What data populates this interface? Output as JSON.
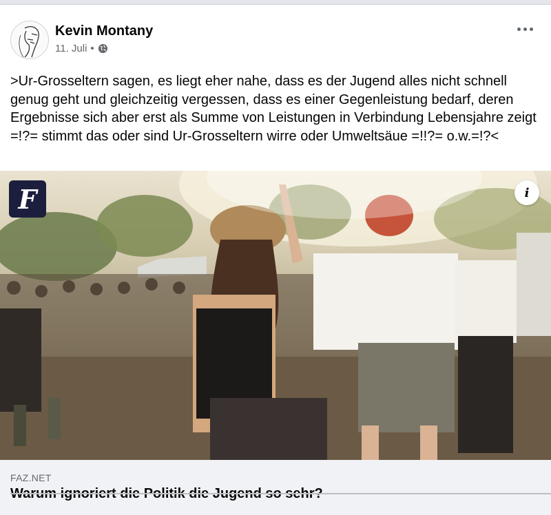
{
  "post": {
    "author": "Kevin Montany",
    "date": "11. Juli",
    "separator": "•",
    "privacy_icon": "globe-icon",
    "more_icon": "more-horizontal-icon",
    "text": ">Ur-Grosseltern sagen, es liegt eher nahe, dass es der Jugend alles nicht schnell genug geht und gleichzeitig vergessen, dass es einer Gegenleistung bedarf, deren Ergebnisse sich aber erst als Summe von Leistungen in Verbindung Lebensjahre zeigt =!?= stimmt das oder sind Ur-Grosseltern wirre oder Umweltsäue =!!?= o.w.=!?<"
  },
  "link_preview": {
    "publisher_logo_letter": "F",
    "info_label": "i",
    "domain": "FAZ.NET",
    "headline": "Warum ignoriert die Politik die Jugend so sehr?",
    "photo_subject": "young people dancing at an outdoor festival"
  },
  "colors": {
    "text": "#050505",
    "secondary": "#65676b",
    "caption_bg": "#f0f2f5",
    "logo_bg": "#1b1f3d"
  }
}
